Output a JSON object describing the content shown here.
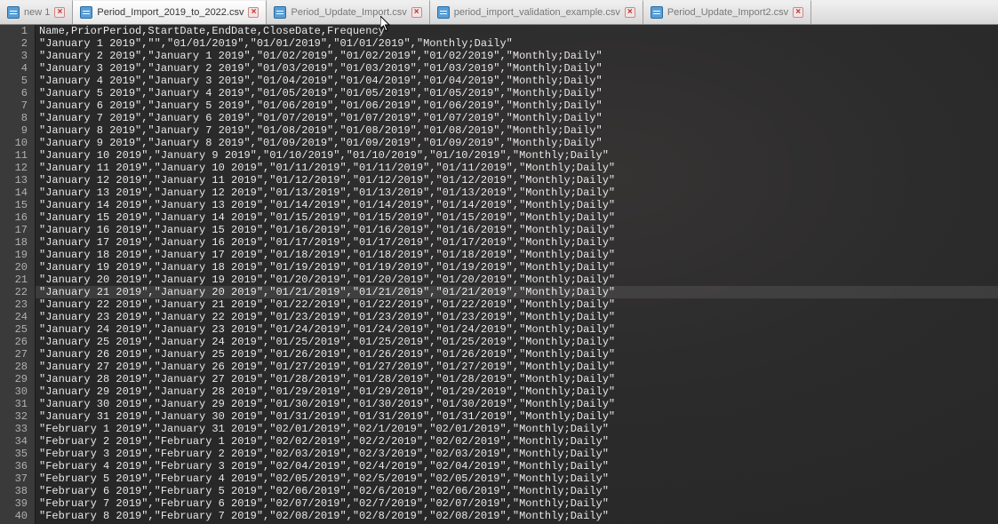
{
  "tabs": [
    {
      "label": "new 1",
      "active": false,
      "closeable": true
    },
    {
      "label": "Period_Import_2019_to_2022.csv",
      "active": true,
      "closeable": true
    },
    {
      "label": "Period_Update_Import.csv",
      "active": false,
      "closeable": true
    },
    {
      "label": "period_import_validation_example.csv",
      "active": false,
      "closeable": true
    },
    {
      "label": "Period_Update_Import2.csv",
      "active": false,
      "closeable": true
    }
  ],
  "highlight_line": 22,
  "lines": [
    "Name,PriorPeriod,StartDate,EndDate,CloseDate,Frequency",
    "\"January 1 2019\",\"\",\"01/01/2019\",\"01/01/2019\",\"01/01/2019\",\"Monthly;Daily\"",
    "\"January 2 2019\",\"January 1 2019\",\"01/02/2019\",\"01/02/2019\",\"01/02/2019\",\"Monthly;Daily\"",
    "\"January 3 2019\",\"January 2 2019\",\"01/03/2019\",\"01/03/2019\",\"01/03/2019\",\"Monthly;Daily\"",
    "\"January 4 2019\",\"January 3 2019\",\"01/04/2019\",\"01/04/2019\",\"01/04/2019\",\"Monthly;Daily\"",
    "\"January 5 2019\",\"January 4 2019\",\"01/05/2019\",\"01/05/2019\",\"01/05/2019\",\"Monthly;Daily\"",
    "\"January 6 2019\",\"January 5 2019\",\"01/06/2019\",\"01/06/2019\",\"01/06/2019\",\"Monthly;Daily\"",
    "\"January 7 2019\",\"January 6 2019\",\"01/07/2019\",\"01/07/2019\",\"01/07/2019\",\"Monthly;Daily\"",
    "\"January 8 2019\",\"January 7 2019\",\"01/08/2019\",\"01/08/2019\",\"01/08/2019\",\"Monthly;Daily\"",
    "\"January 9 2019\",\"January 8 2019\",\"01/09/2019\",\"01/09/2019\",\"01/09/2019\",\"Monthly;Daily\"",
    "\"January 10 2019\",\"January 9 2019\",\"01/10/2019\",\"01/10/2019\",\"01/10/2019\",\"Monthly;Daily\"",
    "\"January 11 2019\",\"January 10 2019\",\"01/11/2019\",\"01/11/2019\",\"01/11/2019\",\"Monthly;Daily\"",
    "\"January 12 2019\",\"January 11 2019\",\"01/12/2019\",\"01/12/2019\",\"01/12/2019\",\"Monthly;Daily\"",
    "\"January 13 2019\",\"January 12 2019\",\"01/13/2019\",\"01/13/2019\",\"01/13/2019\",\"Monthly;Daily\"",
    "\"January 14 2019\",\"January 13 2019\",\"01/14/2019\",\"01/14/2019\",\"01/14/2019\",\"Monthly;Daily\"",
    "\"January 15 2019\",\"January 14 2019\",\"01/15/2019\",\"01/15/2019\",\"01/15/2019\",\"Monthly;Daily\"",
    "\"January 16 2019\",\"January 15 2019\",\"01/16/2019\",\"01/16/2019\",\"01/16/2019\",\"Monthly;Daily\"",
    "\"January 17 2019\",\"January 16 2019\",\"01/17/2019\",\"01/17/2019\",\"01/17/2019\",\"Monthly;Daily\"",
    "\"January 18 2019\",\"January 17 2019\",\"01/18/2019\",\"01/18/2019\",\"01/18/2019\",\"Monthly;Daily\"",
    "\"January 19 2019\",\"January 18 2019\",\"01/19/2019\",\"01/19/2019\",\"01/19/2019\",\"Monthly;Daily\"",
    "\"January 20 2019\",\"January 19 2019\",\"01/20/2019\",\"01/20/2019\",\"01/20/2019\",\"Monthly;Daily\"",
    "\"January 21 2019\",\"January 20 2019\",\"01/21/2019\",\"01/21/2019\",\"01/21/2019\",\"Monthly;Daily\"",
    "\"January 22 2019\",\"January 21 2019\",\"01/22/2019\",\"01/22/2019\",\"01/22/2019\",\"Monthly;Daily\"",
    "\"January 23 2019\",\"January 22 2019\",\"01/23/2019\",\"01/23/2019\",\"01/23/2019\",\"Monthly;Daily\"",
    "\"January 24 2019\",\"January 23 2019\",\"01/24/2019\",\"01/24/2019\",\"01/24/2019\",\"Monthly;Daily\"",
    "\"January 25 2019\",\"January 24 2019\",\"01/25/2019\",\"01/25/2019\",\"01/25/2019\",\"Monthly;Daily\"",
    "\"January 26 2019\",\"January 25 2019\",\"01/26/2019\",\"01/26/2019\",\"01/26/2019\",\"Monthly;Daily\"",
    "\"January 27 2019\",\"January 26 2019\",\"01/27/2019\",\"01/27/2019\",\"01/27/2019\",\"Monthly;Daily\"",
    "\"January 28 2019\",\"January 27 2019\",\"01/28/2019\",\"01/28/2019\",\"01/28/2019\",\"Monthly;Daily\"",
    "\"January 29 2019\",\"January 28 2019\",\"01/29/2019\",\"01/29/2019\",\"01/29/2019\",\"Monthly;Daily\"",
    "\"January 30 2019\",\"January 29 2019\",\"01/30/2019\",\"01/30/2019\",\"01/30/2019\",\"Monthly;Daily\"",
    "\"January 31 2019\",\"January 30 2019\",\"01/31/2019\",\"01/31/2019\",\"01/31/2019\",\"Monthly;Daily\"",
    "\"February 1 2019\",\"January 31 2019\",\"02/01/2019\",\"02/1/2019\",\"02/01/2019\",\"Monthly;Daily\"",
    "\"February 2 2019\",\"February 1 2019\",\"02/02/2019\",\"02/2/2019\",\"02/02/2019\",\"Monthly;Daily\"",
    "\"February 3 2019\",\"February 2 2019\",\"02/03/2019\",\"02/3/2019\",\"02/03/2019\",\"Monthly;Daily\"",
    "\"February 4 2019\",\"February 3 2019\",\"02/04/2019\",\"02/4/2019\",\"02/04/2019\",\"Monthly;Daily\"",
    "\"February 5 2019\",\"February 4 2019\",\"02/05/2019\",\"02/5/2019\",\"02/05/2019\",\"Monthly;Daily\"",
    "\"February 6 2019\",\"February 5 2019\",\"02/06/2019\",\"02/6/2019\",\"02/06/2019\",\"Monthly;Daily\"",
    "\"February 7 2019\",\"February 6 2019\",\"02/07/2019\",\"02/7/2019\",\"02/07/2019\",\"Monthly;Daily\"",
    "\"February 8 2019\",\"February 7 2019\",\"02/08/2019\",\"02/8/2019\",\"02/08/2019\",\"Monthly;Daily\""
  ]
}
